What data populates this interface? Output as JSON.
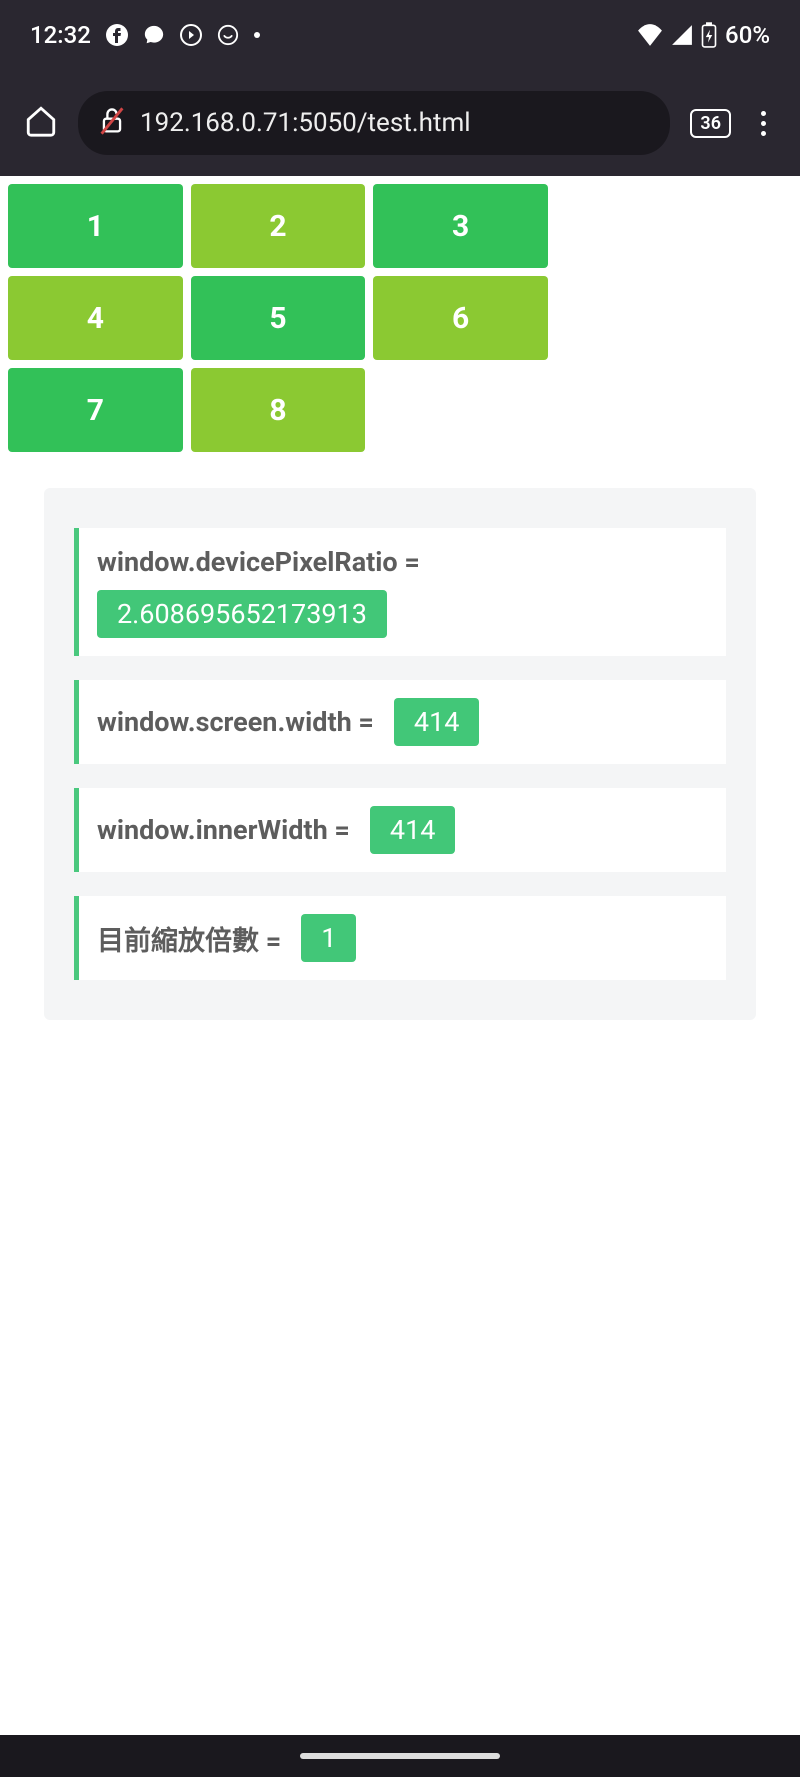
{
  "statusBar": {
    "time": "12:32",
    "battery": "60%"
  },
  "browser": {
    "url": "192.168.0.71:5050/test.html",
    "tabCount": "36"
  },
  "grid": {
    "cells": [
      "1",
      "2",
      "3",
      "4",
      "5",
      "6",
      "7",
      "8"
    ]
  },
  "info": {
    "rows": [
      {
        "label": "window.devicePixelRatio =",
        "value": "2.608695652173913"
      },
      {
        "label": "window.screen.width =",
        "value": "414"
      },
      {
        "label": "window.innerWidth =",
        "value": "414"
      },
      {
        "label": "目前縮放倍數 =",
        "value": "1"
      }
    ]
  }
}
